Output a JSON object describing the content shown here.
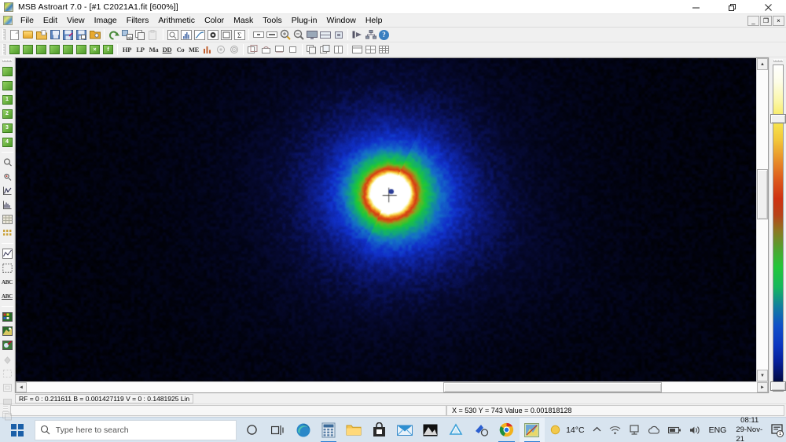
{
  "window": {
    "title": "MSB Astroart 7.0 - [#1 C2021A1.fit  [600%]]",
    "app_icon": "astroart-icon",
    "controls": {
      "minimize": "minimize-icon",
      "restore": "restore-icon",
      "close": "close-icon"
    },
    "mdi_controls": {
      "minimize": "_",
      "restore": "❐",
      "close": "×"
    }
  },
  "menubar": {
    "icon": "document-icon",
    "items": [
      {
        "label": "File"
      },
      {
        "label": "Edit"
      },
      {
        "label": "View"
      },
      {
        "label": "Image"
      },
      {
        "label": "Filters"
      },
      {
        "label": "Arithmetic"
      },
      {
        "label": "Color"
      },
      {
        "label": "Mask"
      },
      {
        "label": "Tools"
      },
      {
        "label": "Plug-in"
      },
      {
        "label": "Window"
      },
      {
        "label": "Help"
      }
    ]
  },
  "toolbar_top": {
    "groups": [
      {
        "buttons": [
          {
            "name": "new-file-button",
            "icon": "new-document-icon"
          },
          {
            "name": "open-file-button",
            "icon": "open-folder-icon"
          },
          {
            "name": "open-recent-button",
            "icon": "folder-page-icon"
          },
          {
            "name": "save-button",
            "icon": "floppy-disk-icon"
          },
          {
            "name": "save-as-button",
            "icon": "floppy-disk-pen-icon"
          },
          {
            "name": "save-all-button",
            "icon": "floppy-disk-multi-icon"
          },
          {
            "name": "batch-button",
            "icon": "folder-gear-icon"
          }
        ]
      },
      {
        "buttons": [
          {
            "name": "undo-button",
            "icon": "undo-arrow-icon"
          },
          {
            "name": "convert-button",
            "icon": "convert-icon"
          },
          {
            "name": "copy-button",
            "icon": "copy-icon"
          },
          {
            "name": "paste-button",
            "icon": "paste-icon"
          }
        ]
      },
      {
        "buttons": [
          {
            "name": "preview-button",
            "icon": "preview-icon"
          },
          {
            "name": "histogram-button",
            "icon": "histogram-icon"
          },
          {
            "name": "curve-button",
            "icon": "curve-icon"
          },
          {
            "name": "photometry-button",
            "icon": "photometry-icon"
          },
          {
            "name": "frame-button",
            "icon": "frame-icon"
          },
          {
            "name": "statistics-button",
            "icon": "sigma-icon"
          }
        ]
      },
      {
        "buttons": [
          {
            "name": "zoom-fit-width-button",
            "icon": "fit-width-icon"
          },
          {
            "name": "zoom-fit-button",
            "icon": "fit-icon"
          },
          {
            "name": "zoom-in-button",
            "icon": "zoom-in-icon"
          },
          {
            "name": "zoom-out-button",
            "icon": "zoom-out-icon"
          },
          {
            "name": "full-screen-button",
            "icon": "monitor-icon"
          },
          {
            "name": "tile-view-button",
            "icon": "tile-icon"
          },
          {
            "name": "center-view-button",
            "icon": "center-icon"
          }
        ]
      },
      {
        "buttons": [
          {
            "name": "export-button",
            "icon": "export-icon"
          },
          {
            "name": "network-button",
            "icon": "network-icon"
          },
          {
            "name": "help-button",
            "icon": "help-question-icon"
          }
        ]
      }
    ]
  },
  "toolbar_second": {
    "groups": [
      {
        "buttons": [
          {
            "name": "calibrate-1-button",
            "icon": "green-frame-icon",
            "label": ""
          },
          {
            "name": "calibrate-2-button",
            "icon": "green-frame-icon",
            "label": ""
          },
          {
            "name": "calibrate-3-button",
            "icon": "green-frame-icon",
            "label": ""
          },
          {
            "name": "calibrate-4-button",
            "icon": "green-frame-icon",
            "label": ""
          },
          {
            "name": "calibrate-5-button",
            "icon": "green-frame-icon",
            "label": ""
          },
          {
            "name": "calibrate-6-button",
            "icon": "green-frame-icon",
            "label": ""
          },
          {
            "name": "calibrate-7-button",
            "icon": "green-frame-x-icon",
            "label": ""
          },
          {
            "name": "calibrate-8-button",
            "icon": "green-frame-f-icon",
            "label": ""
          }
        ]
      },
      {
        "buttons": [
          {
            "name": "high-pass-filter-button",
            "icon": "text-label-icon",
            "label": "HP"
          },
          {
            "name": "low-pass-filter-button",
            "icon": "text-label-icon",
            "label": "LP"
          },
          {
            "name": "maximum-filter-button",
            "icon": "text-label-icon",
            "label": "Ma"
          },
          {
            "name": "digital-development-button",
            "icon": "text-label-icon",
            "label": "DD"
          },
          {
            "name": "convolution-button",
            "icon": "text-label-icon",
            "label": "Co"
          },
          {
            "name": "maximum-entropy-button",
            "icon": "text-label-icon",
            "label": "ME"
          },
          {
            "name": "levels-button",
            "icon": "bar-levels-icon",
            "label": ""
          },
          {
            "name": "deconvolution-button",
            "icon": "star-blur-icon",
            "label": ""
          },
          {
            "name": "unsharp-mask-button",
            "icon": "star-sharp-icon",
            "label": ""
          }
        ]
      },
      {
        "buttons": [
          {
            "name": "select-rect-button",
            "icon": "rect-select-icon",
            "label": ""
          },
          {
            "name": "select-ellipse-button",
            "icon": "ellipse-select-icon",
            "label": ""
          },
          {
            "name": "select-poly-button",
            "icon": "polygon-select-icon",
            "label": ""
          },
          {
            "name": "select-none-button",
            "icon": "deselect-icon",
            "label": ""
          }
        ]
      },
      {
        "buttons": [
          {
            "name": "duplicate-button",
            "icon": "duplicate-icon",
            "label": ""
          },
          {
            "name": "layers-button",
            "icon": "layers-icon",
            "label": ""
          },
          {
            "name": "split-button",
            "icon": "split-icon",
            "label": ""
          }
        ]
      },
      {
        "buttons": [
          {
            "name": "window-cascade-button",
            "icon": "cascade-icon",
            "label": ""
          },
          {
            "name": "window-tile-h-button",
            "icon": "tile-h-icon",
            "label": ""
          },
          {
            "name": "window-tile-grid-button",
            "icon": "tile-grid-icon",
            "label": ""
          }
        ]
      }
    ]
  },
  "toolbar_left": {
    "groups": [
      {
        "buttons": [
          {
            "name": "tool-frame-button",
            "icon": "green-square-icon",
            "label": ""
          },
          {
            "name": "tool-flip-button",
            "icon": "green-half-icon",
            "label": ""
          },
          {
            "name": "tool-preset-1-button",
            "icon": "green-num-icon",
            "label": "1"
          },
          {
            "name": "tool-preset-2-button",
            "icon": "green-num-icon",
            "label": "2"
          },
          {
            "name": "tool-preset-3-button",
            "icon": "green-num-icon",
            "label": "3"
          },
          {
            "name": "tool-preset-4-button",
            "icon": "green-num-icon",
            "label": "4"
          }
        ]
      },
      {
        "buttons": [
          {
            "name": "aperture-tool-button",
            "icon": "aperture-icon",
            "label": ""
          },
          {
            "name": "star-marker-tool-button",
            "icon": "star-marker-icon",
            "label": ""
          },
          {
            "name": "profile-tool-button",
            "icon": "profile-graph-icon",
            "label": ""
          },
          {
            "name": "profile-3d-tool-button",
            "icon": "profile-3d-icon",
            "label": ""
          },
          {
            "name": "pixel-table-button",
            "icon": "pixel-table-icon",
            "label": ""
          },
          {
            "name": "grid-tool-button",
            "icon": "grid-icon",
            "label": ""
          }
        ]
      },
      {
        "buttons": [
          {
            "name": "chart-tool-button",
            "icon": "chart-icon",
            "label": ""
          },
          {
            "name": "marquee-tool-button",
            "icon": "marquee-icon",
            "label": ""
          },
          {
            "name": "text-tool-button",
            "icon": "abc-text-icon",
            "label": "ABC"
          },
          {
            "name": "annotate-tool-button",
            "icon": "abc-annotate-icon",
            "label": "ABC"
          }
        ]
      },
      {
        "buttons": [
          {
            "name": "palette-tool-button",
            "icon": "color-palette-icon",
            "label": ""
          },
          {
            "name": "color-balance-button",
            "icon": "color-balance-icon",
            "label": ""
          },
          {
            "name": "color-picker-button",
            "icon": "color-picker-icon",
            "label": ""
          },
          {
            "name": "fill-tool-button",
            "icon": "fill-bucket-icon",
            "label": ""
          },
          {
            "name": "crop-tool-button",
            "icon": "crop-icon",
            "label": ""
          },
          {
            "name": "resize-tool-button",
            "icon": "resize-icon",
            "label": ""
          },
          {
            "name": "mask-tool-button",
            "icon": "mask-icon",
            "label": ""
          },
          {
            "name": "clone-tool-button",
            "icon": "clone-icon",
            "label": ""
          }
        ]
      }
    ]
  },
  "image": {
    "name": "fits-image-canvas",
    "filename": "C2021A1.fit",
    "zoom_percent": "600%",
    "description": "false-color comet coma with bright white-yellow core, red-orange ring, green shell and blue halo on near-black background, faint tail toward upper right",
    "palette": {
      "name": "lut-palette-strip",
      "stops": [
        "#ffffff",
        "#f7e851",
        "#e8902a",
        "#cf3212",
        "#22c63a",
        "#127f9e",
        "#1050c8",
        "#000000"
      ]
    },
    "marker": "crosshair-marker"
  },
  "status": {
    "levels": "RF = 0 : 0.211611   B = 0.001427119   V = 0 : 0.1481925 Lin",
    "message": "",
    "coords": "X = 530   Y = 743   Value = 0.001818128"
  },
  "scrollbars": {
    "vertical": {
      "up": "▲",
      "down": "▼"
    },
    "horizontal": {
      "left": "◄",
      "right": "►"
    }
  },
  "taskbar": {
    "start": "windows-start-icon",
    "search": {
      "icon": "search-icon",
      "placeholder": "Type here to search"
    },
    "cortana": "cortana-circle-icon",
    "taskview": "task-view-icon",
    "apps": [
      {
        "name": "taskbar-edge",
        "icon": "edge-icon",
        "running": false
      },
      {
        "name": "taskbar-calculator",
        "icon": "calculator-icon",
        "running": true
      },
      {
        "name": "taskbar-file-explorer",
        "icon": "file-explorer-icon",
        "running": false
      },
      {
        "name": "taskbar-store",
        "icon": "microsoft-store-icon",
        "running": false
      },
      {
        "name": "taskbar-mail",
        "icon": "mail-icon",
        "running": false
      },
      {
        "name": "taskbar-photo-viewer",
        "icon": "photo-dark-icon",
        "running": false
      },
      {
        "name": "taskbar-drive",
        "icon": "triangle-app-icon",
        "running": false
      },
      {
        "name": "taskbar-blue-app",
        "icon": "blue-tool-icon",
        "running": false
      },
      {
        "name": "taskbar-chrome",
        "icon": "chrome-icon",
        "running": true
      },
      {
        "name": "taskbar-astroart",
        "icon": "astroart-icon",
        "running": true,
        "active": true
      }
    ],
    "tray": {
      "weather_icon": "sun-icon",
      "temperature": "14°C",
      "chevron": "⌃",
      "wifi": "wifi-icon",
      "onedrive": "onedrive-icon",
      "cloud": "cloud-icon",
      "battery": "battery-icon",
      "volume": "speaker-icon",
      "language": "ENG",
      "time": "08:11",
      "date": "29-Nov-21",
      "notifications": "notification-icon",
      "notification_count": "1"
    }
  }
}
